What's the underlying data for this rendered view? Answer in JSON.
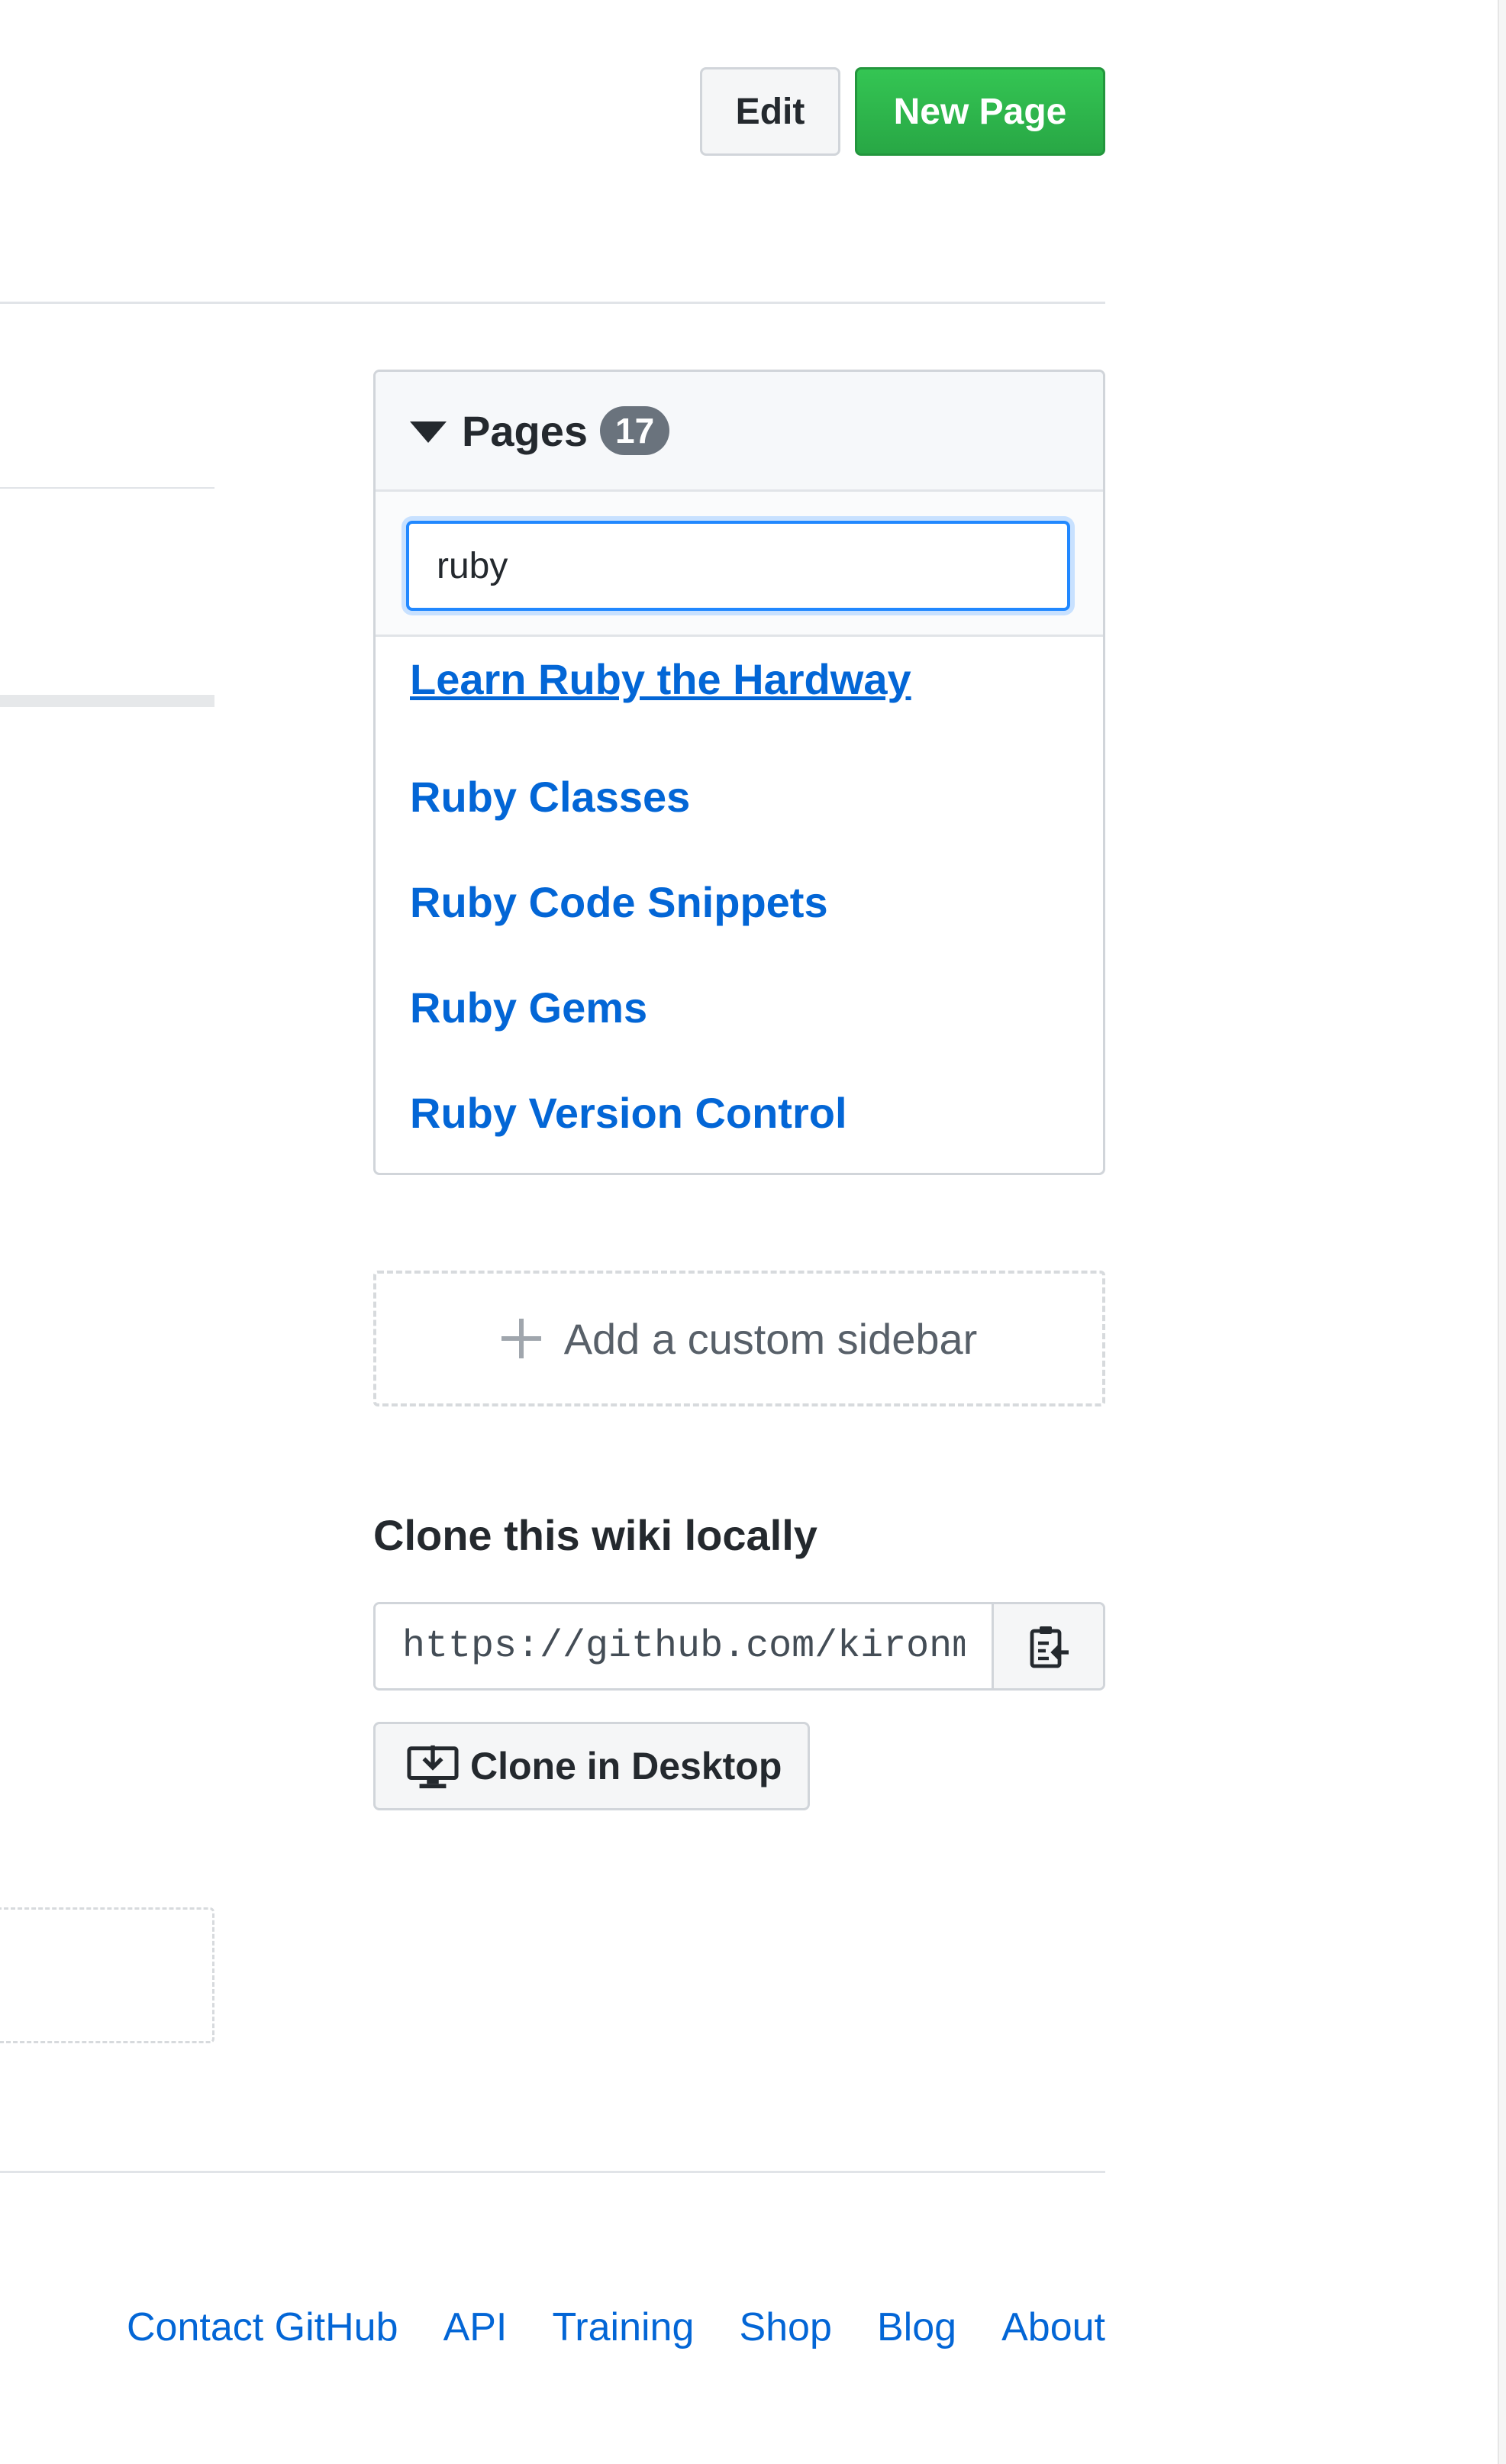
{
  "header": {
    "edit_label": "Edit",
    "new_page_label": "New Page"
  },
  "pages": {
    "title": "Pages",
    "count": "17",
    "filter_value": "ruby",
    "results": [
      {
        "label": "Learn Ruby the Hardway"
      },
      {
        "label": "Ruby Classes"
      },
      {
        "label": "Ruby Code Snippets"
      },
      {
        "label": "Ruby Gems"
      },
      {
        "label": "Ruby Version Control"
      }
    ]
  },
  "sidebar": {
    "add_custom_label": "Add a custom sidebar"
  },
  "clone": {
    "title": "Clone this wiki locally",
    "url": "https://github.com/kironmukherjee",
    "desktop_label": "Clone in Desktop"
  },
  "footer": {
    "links": [
      {
        "label": "Contact GitHub"
      },
      {
        "label": "API"
      },
      {
        "label": "Training"
      },
      {
        "label": "Shop"
      },
      {
        "label": "Blog"
      },
      {
        "label": "About"
      }
    ]
  },
  "colors": {
    "link": "#0366d6",
    "primary": "#28a745",
    "focus": "#2188ff"
  }
}
